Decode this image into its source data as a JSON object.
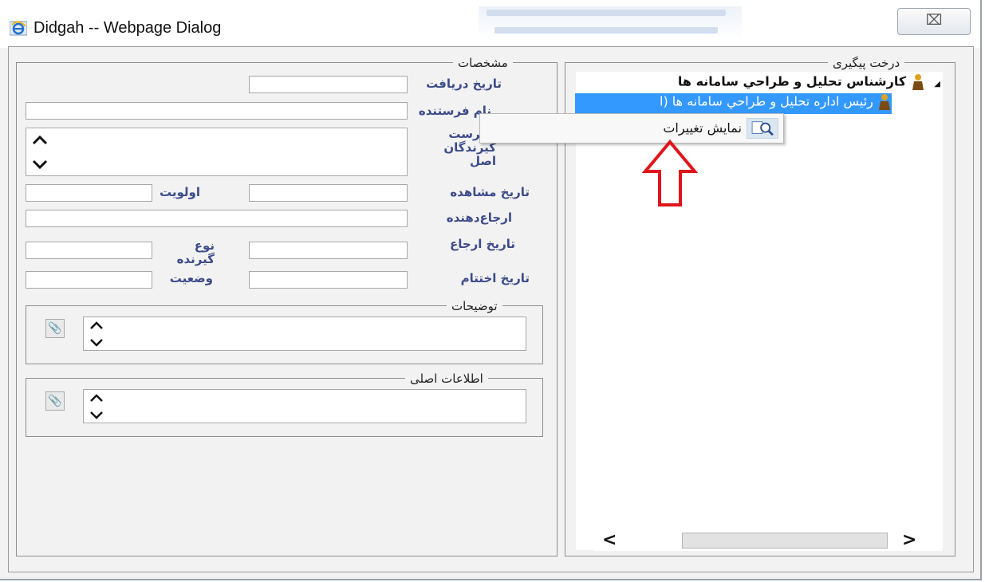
{
  "window": {
    "title": "Didgah -- Webpage Dialog",
    "close_glyph": "⌧"
  },
  "form": {
    "legend": "مشخصات",
    "received_date_label": "تاريخ دريافت",
    "sender_name_label": "نام فرستنده",
    "recipients_label": "فهرست گيرندگان اصل",
    "view_date_label": "تاريخ مشاهده",
    "priority_label": "اولويت",
    "referrer_label": "ارجاع‌دهنده",
    "referral_date_label": "تاريخ ارجاع",
    "recipient_type_label": "نوع گيرنده",
    "close_date_label": "تاريخ اختتام",
    "status_label": "وضعيت",
    "notes_legend": "توضيحات",
    "main_info_legend": "اطلاعات اصلی"
  },
  "tree": {
    "legend": "درخت پیگیری",
    "root_label": "كارشناس تحليل و طراحي سامانه ها",
    "child_label": "رئيس اداره تحليل و طراحي سامانه ها (ا",
    "expand_glyph": "◢"
  },
  "context_menu": {
    "show_changes_label": "نمایش تغییرات"
  },
  "scrollbar": {
    "left_glyph": "<",
    "right_glyph": ">"
  },
  "colors": {
    "label_blue": "#3c4b8a",
    "selection_blue": "#3399ff",
    "arrow_red": "#e0151b"
  }
}
